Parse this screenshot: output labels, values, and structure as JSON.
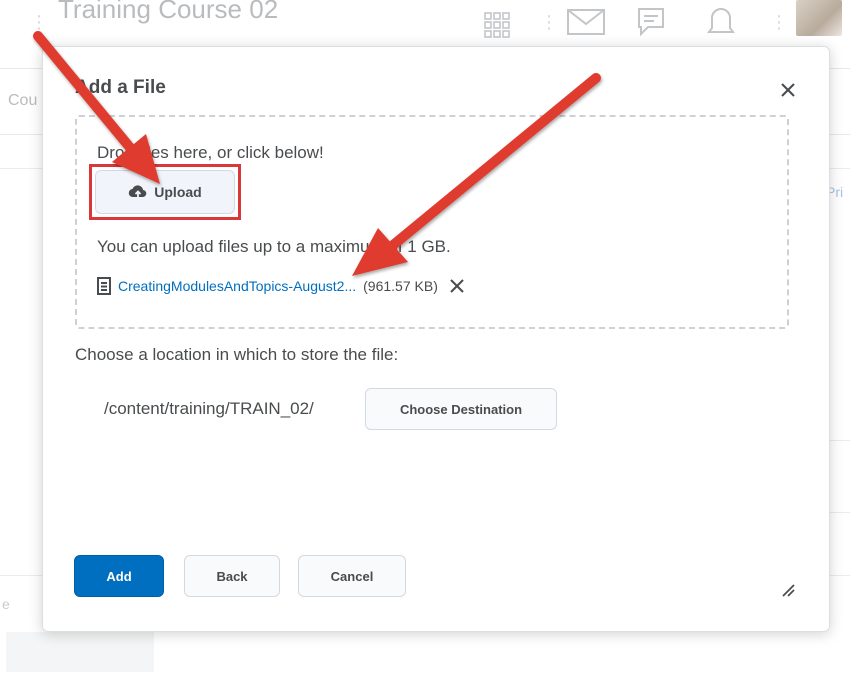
{
  "background": {
    "course_title": "Training Course 02",
    "course_nav_partial": "Cou",
    "right_link_partial": "Pri",
    "left_partial": "e",
    "icons": [
      "grid-icon",
      "mail-icon",
      "chat-icon",
      "bell-icon",
      "avatar"
    ]
  },
  "dialog": {
    "title": "Add a File",
    "close_icon": "close-icon",
    "dropzone": {
      "instruction": "Drop files here, or click below!",
      "upload_label": "Upload",
      "upload_icon": "cloud-upload-icon",
      "max_size_text": "You can upload files up to a maximum of 1 GB.",
      "file": {
        "icon": "document-icon",
        "name": "CreatingModulesAndTopics-August2...",
        "size": "(961.57 KB)",
        "remove_icon": "close-icon"
      }
    },
    "location_label": "Choose a location in which to store the file:",
    "destination_path": "/content/training/TRAIN_02/",
    "choose_destination_label": "Choose Destination",
    "buttons": {
      "add": "Add",
      "back": "Back",
      "cancel": "Cancel"
    }
  },
  "colors": {
    "primary": "#006fbf",
    "annotation_red": "#d9383a",
    "text": "#494c4e"
  }
}
